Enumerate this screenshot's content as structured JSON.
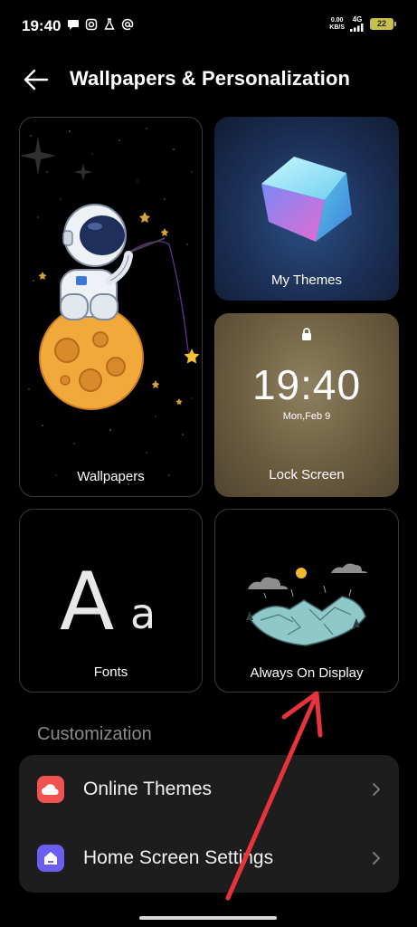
{
  "status_bar": {
    "time": "19:40",
    "net_speed_value": "0.00",
    "net_speed_unit": "KB/S",
    "network": "4G",
    "battery": "22",
    "icons": [
      "message-icon",
      "instagram-icon",
      "lab-flask-icon",
      "at-sign-icon",
      "signal-icon",
      "battery-icon"
    ]
  },
  "header": {
    "title": "Wallpapers & Personalization",
    "back_icon": "back-arrow-icon"
  },
  "cards": {
    "wallpapers": {
      "label": "Wallpapers"
    },
    "themes": {
      "label": "My Themes"
    },
    "lock_screen": {
      "label": "Lock Screen",
      "time": "19:40",
      "date": "Mon,Feb 9"
    },
    "fonts": {
      "label": "Fonts",
      "glyph_big": "A",
      "glyph_small": "a"
    },
    "aod": {
      "label": "Always On Display"
    }
  },
  "customization": {
    "title": "Customization",
    "items": [
      {
        "label": "Online Themes",
        "icon": "cloud-icon",
        "icon_color": "#f0524f"
      },
      {
        "label": "Home Screen Settings",
        "icon": "home-icon",
        "icon_color": "#6a5ef0"
      }
    ]
  },
  "colors": {
    "background": "#000000",
    "panel": "#1d1d1d",
    "annotation_arrow": "#e8323c"
  }
}
